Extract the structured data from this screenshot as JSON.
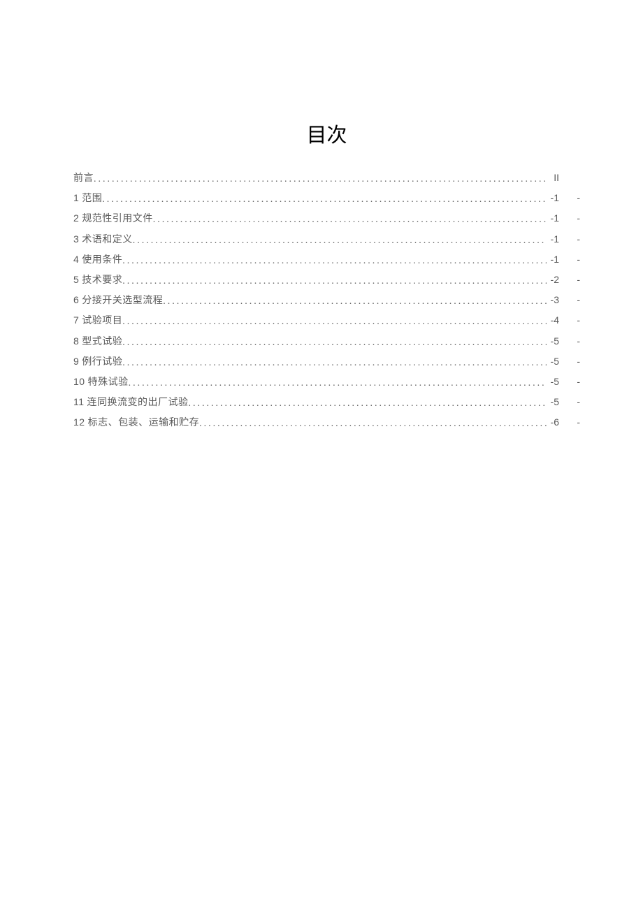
{
  "title": "目次",
  "entries": [
    {
      "num": "",
      "label": "前言",
      "page": "II",
      "dash": false
    },
    {
      "num": "1",
      "label": " 范围",
      "page": "-1",
      "dash": true
    },
    {
      "num": "2",
      "label": " 规范性引用文件",
      "page": "-1",
      "dash": true
    },
    {
      "num": "3",
      "label": " 术语和定义",
      "page": "-1",
      "dash": true
    },
    {
      "num": "4",
      "label": " 使用条件",
      "page": "-1",
      "dash": true
    },
    {
      "num": "5",
      "label": " 技术要求",
      "page": "-2",
      "dash": true
    },
    {
      "num": "6",
      "label": " 分接开关选型流程",
      "page": "-3",
      "dash": true
    },
    {
      "num": "7",
      "label": " 试验项目",
      "page": "-4",
      "dash": true
    },
    {
      "num": "8",
      "label": " 型式试验",
      "page": "-5",
      "dash": true
    },
    {
      "num": "9",
      "label": " 例行试验",
      "page": "-5",
      "dash": true
    },
    {
      "num": "10",
      "label": " 特殊试验",
      "page": "-5",
      "dash": true
    },
    {
      "num": "11",
      "label": " 连同换流变的出厂试验",
      "page": "-5",
      "dash": true
    },
    {
      "num": "12",
      "label": " 标志、包装、运输和贮存",
      "page": "-6",
      "dash": true
    }
  ]
}
